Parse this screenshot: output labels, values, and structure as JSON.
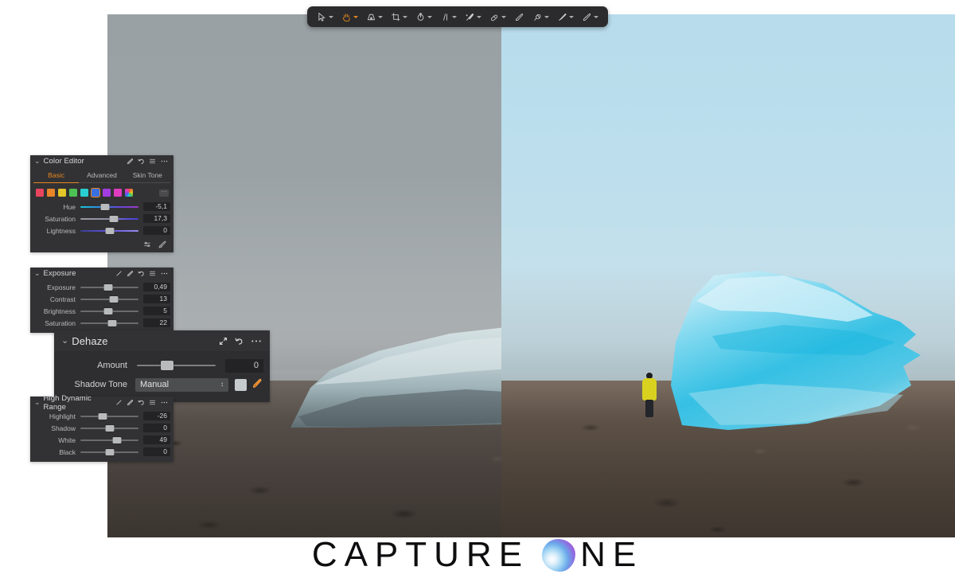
{
  "toolbar": {
    "tools": [
      {
        "name": "select-cursor-tool",
        "icon": "cursor-arrow-icon",
        "active": false,
        "has_caret": true
      },
      {
        "name": "pan-hand-tool",
        "icon": "hand-icon",
        "active": true,
        "has_caret": true
      },
      {
        "name": "keystone-tool",
        "icon": "keystone-icon",
        "active": false,
        "has_caret": true
      },
      {
        "name": "crop-tool",
        "icon": "crop-icon",
        "active": false,
        "has_caret": true
      },
      {
        "name": "rotate-tool",
        "icon": "rotate-icon",
        "active": false,
        "has_caret": true
      },
      {
        "name": "straighten-tool",
        "icon": "straighten-lines-icon",
        "active": false,
        "has_caret": true
      },
      {
        "name": "spot-removal-tool",
        "icon": "spot-brush-icon",
        "active": false,
        "has_caret": true
      },
      {
        "name": "heal-tool",
        "icon": "heal-patch-icon",
        "active": false,
        "has_caret": true
      },
      {
        "name": "erase-tool",
        "icon": "eraser-icon",
        "active": false,
        "has_caret": false
      },
      {
        "name": "clone-tool",
        "icon": "clone-stamp-icon",
        "active": false,
        "has_caret": true
      },
      {
        "name": "fill-mask-tool",
        "icon": "fill-brush-icon",
        "active": false,
        "has_caret": true
      },
      {
        "name": "draw-mask-tool",
        "icon": "pen-draw-icon",
        "active": false,
        "has_caret": true
      }
    ]
  },
  "color_editor": {
    "title": "Color Editor",
    "collapse_icon": "chevron-down-icon",
    "head_icons": [
      "color-picker-icon",
      "reset-arrow-icon",
      "hamburger-menu-icon",
      "ellipsis-menu-icon"
    ],
    "tabs": [
      {
        "label": "Basic",
        "selected": true
      },
      {
        "label": "Advanced",
        "selected": false
      },
      {
        "label": "Skin Tone",
        "selected": false
      }
    ],
    "swatches": [
      {
        "name": "swatch-red",
        "color": "#e8455e",
        "selected": false
      },
      {
        "name": "swatch-orange",
        "color": "#e8852a",
        "selected": false
      },
      {
        "name": "swatch-yellow",
        "color": "#e3c628",
        "selected": false
      },
      {
        "name": "swatch-green",
        "color": "#4dc254",
        "selected": false
      },
      {
        "name": "swatch-cyan",
        "color": "#29cfd0",
        "selected": false
      },
      {
        "name": "swatch-blue",
        "color": "#3a6fe0",
        "selected": true
      },
      {
        "name": "swatch-purple",
        "color": "#a13ce0",
        "selected": false
      },
      {
        "name": "swatch-magenta",
        "color": "#e03cc0",
        "selected": false
      },
      {
        "name": "swatch-rainbow",
        "color": "rainbow",
        "selected": false
      }
    ],
    "more_swatches_label": "⋯",
    "sliders": [
      {
        "label": "Hue",
        "value": "-5,1",
        "pos": 42,
        "track": "hue"
      },
      {
        "label": "Saturation",
        "value": "17,3",
        "pos": 57,
        "track": "sat"
      },
      {
        "label": "Lightness",
        "value": "0",
        "pos": 50,
        "track": "lgt"
      }
    ],
    "footer_icons": [
      "smoothness-sliders-icon",
      "color-picker-icon"
    ]
  },
  "exposure": {
    "title": "Exposure",
    "collapse_icon": "chevron-down-icon",
    "head_icons": [
      "brush-icon",
      "color-picker-icon",
      "reset-arrow-icon",
      "hamburger-menu-icon",
      "ellipsis-menu-icon"
    ],
    "sliders": [
      {
        "label": "Exposure",
        "value": "0,49",
        "pos": 48
      },
      {
        "label": "Contrast",
        "value": "13",
        "pos": 57
      },
      {
        "label": "Brightness",
        "value": "5",
        "pos": 48
      },
      {
        "label": "Saturation",
        "value": "22",
        "pos": 55
      }
    ]
  },
  "dehaze": {
    "title": "Dehaze",
    "collapse_icon": "chevron-down-icon",
    "head_icons": [
      "expand-arrows-icon",
      "reset-arrow-icon",
      "ellipsis-menu-icon"
    ],
    "amount": {
      "label": "Amount",
      "value": "0",
      "pos": 38
    },
    "shadow_tone": {
      "label": "Shadow Tone",
      "value": "Manual",
      "spinner_icon": "stepper-updown-icon",
      "chip_name": "shadow-tone-color-chip",
      "chip_color": "#c6ccce",
      "picker_icon": "eyedropper-icon"
    }
  },
  "hdr": {
    "title": "High Dynamic Range",
    "collapse_icon": "chevron-down-icon",
    "head_icons": [
      "brush-icon",
      "color-picker-icon",
      "reset-arrow-icon",
      "hamburger-menu-icon",
      "ellipsis-menu-icon"
    ],
    "sliders": [
      {
        "label": "Highlight",
        "value": "-26",
        "pos": 39
      },
      {
        "label": "Shadow",
        "value": "0",
        "pos": 50
      },
      {
        "label": "White",
        "value": "49",
        "pos": 63
      },
      {
        "label": "Black",
        "value": "0",
        "pos": 50
      }
    ]
  },
  "logo": {
    "word_left": "CAPTURE",
    "word_right": "NE",
    "orb_name": "capture-one-orb-icon"
  },
  "photo": {
    "alt_left": "iceberg-unedited-gray",
    "alt_right": "iceberg-edited-blue",
    "sky_left_color": "#9aa1a5",
    "sky_right_color": "#b8dcec",
    "person_jacket_color": "#d9d11f"
  }
}
